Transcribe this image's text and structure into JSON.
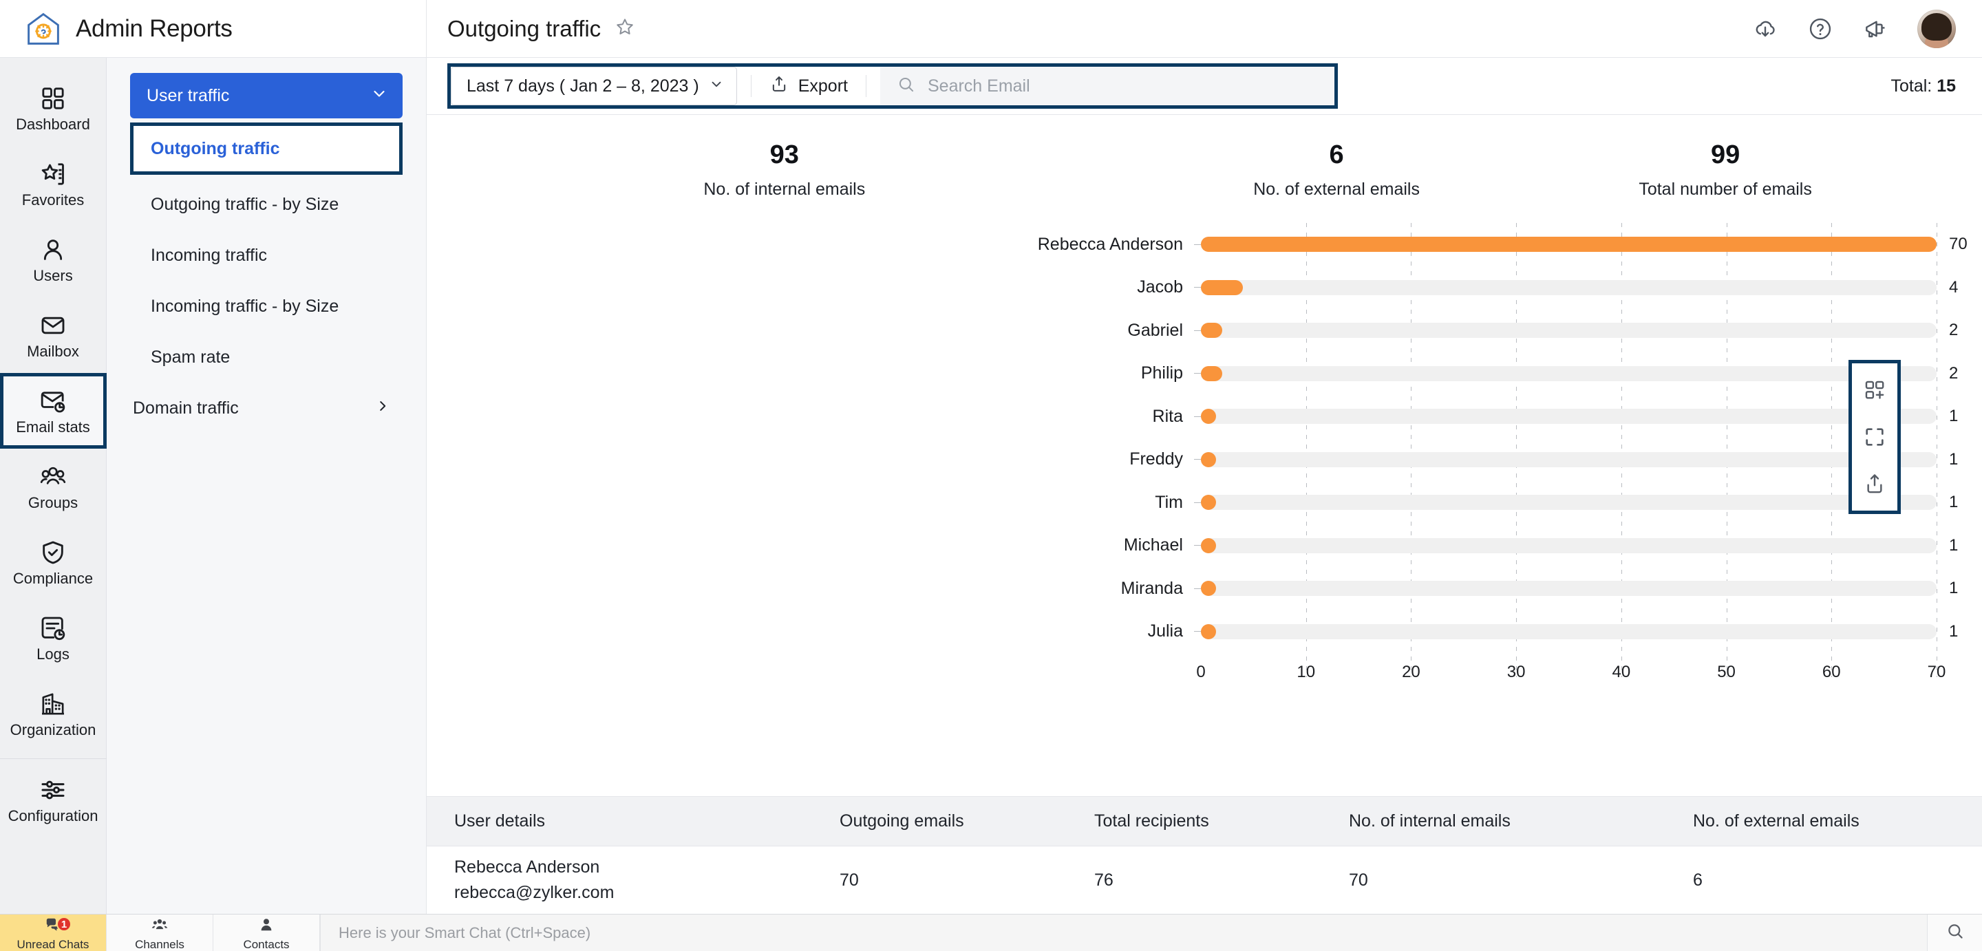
{
  "brand": {
    "title": "Admin Reports",
    "logo_icon": "home-gear-logo-icon"
  },
  "header": {
    "page_title": "Outgoing traffic",
    "star_icon": "star-outline-icon",
    "actions": [
      {
        "name": "cloud-download-icon",
        "label": "Download"
      },
      {
        "name": "help-circle-icon",
        "label": "Help"
      },
      {
        "name": "megaphone-icon",
        "label": "Announcements"
      }
    ],
    "avatar_label": "User profile"
  },
  "rail": {
    "items": [
      {
        "label": "Dashboard",
        "icon": "grid-squares-icon",
        "selected": false
      },
      {
        "label": "Favorites",
        "icon": "star-list-icon",
        "selected": false
      },
      {
        "label": "Users",
        "icon": "user-icon",
        "selected": false
      },
      {
        "label": "Mailbox",
        "icon": "envelope-icon",
        "selected": false
      },
      {
        "label": "Email stats",
        "icon": "envelope-chart-icon",
        "selected": true
      },
      {
        "label": "Groups",
        "icon": "group-people-icon",
        "selected": false
      },
      {
        "label": "Compliance",
        "icon": "shield-check-icon",
        "selected": false
      },
      {
        "label": "Logs",
        "icon": "log-clock-icon",
        "selected": false
      },
      {
        "label": "Organization",
        "icon": "building-icon",
        "selected": false
      },
      {
        "label": "Configuration",
        "icon": "sliders-icon",
        "selected": false
      }
    ]
  },
  "subnav": {
    "header_label": "User traffic",
    "header_icon": "chevron-down-icon",
    "items": [
      {
        "label": "Outgoing traffic",
        "active": true,
        "chevron": false
      },
      {
        "label": "Outgoing traffic - by Size",
        "active": false,
        "chevron": false
      },
      {
        "label": "Incoming traffic",
        "active": false,
        "chevron": false
      },
      {
        "label": "Incoming traffic - by Size",
        "active": false,
        "chevron": false
      },
      {
        "label": "Spam rate",
        "active": false,
        "chevron": false
      },
      {
        "label": "Domain traffic",
        "active": false,
        "chevron": true
      }
    ]
  },
  "toolbar": {
    "daterange_label": "Last 7 days ( Jan 2 – 8, 2023 )",
    "daterange_icon": "chevron-down-icon",
    "export_label": "Export",
    "export_icon": "upload-box-icon",
    "search_icon": "search-icon",
    "search_placeholder": "Search Email",
    "search_value": "",
    "total_label": "Total:",
    "total_value": "15"
  },
  "kpis": [
    {
      "value": "93",
      "label": "No. of internal emails"
    },
    {
      "value": "6",
      "label": "No. of external emails"
    },
    {
      "value": "99",
      "label": "Total number of emails"
    }
  ],
  "chart_tools": [
    {
      "name": "add-widget-icon",
      "label": "Add widget"
    },
    {
      "name": "fullscreen-icon",
      "label": "Expand"
    },
    {
      "name": "share-icon",
      "label": "Share"
    }
  ],
  "chart_data": {
    "type": "bar",
    "orientation": "horizontal",
    "title": "",
    "xlabel": "",
    "ylabel": "",
    "categories": [
      "Rebecca Anderson",
      "Jacob",
      "Gabriel",
      "Philip",
      "Rita",
      "Freddy",
      "Tim",
      "Michael",
      "Miranda",
      "Julia"
    ],
    "values": [
      70,
      4,
      2,
      2,
      1,
      1,
      1,
      1,
      1,
      1
    ],
    "xlim": [
      0,
      70
    ],
    "xticks": [
      0,
      10,
      20,
      30,
      40,
      50,
      60,
      70
    ],
    "grid": true,
    "legend": false,
    "bar_color": "#f9943b",
    "track_color": "#f0f0f0"
  },
  "table": {
    "columns": [
      "User details",
      "Outgoing emails",
      "Total recipients",
      "No. of internal emails",
      "No. of external emails"
    ],
    "rows": [
      {
        "name": "Rebecca Anderson",
        "email": "rebecca@zylker.com",
        "outgoing": "70",
        "recipients": "76",
        "internal": "70",
        "external": "6"
      }
    ]
  },
  "bottombar": {
    "tabs": [
      {
        "label": "Unread Chats",
        "icon": "chat-bubbles-icon",
        "badge": "1",
        "active": true
      },
      {
        "label": "Channels",
        "icon": "channels-icon",
        "badge": "",
        "active": false
      },
      {
        "label": "Contacts",
        "icon": "contact-icon",
        "badge": "",
        "active": false
      }
    ],
    "input_placeholder": "Here is your Smart Chat (Ctrl+Space)",
    "search_icon": "search-icon"
  }
}
